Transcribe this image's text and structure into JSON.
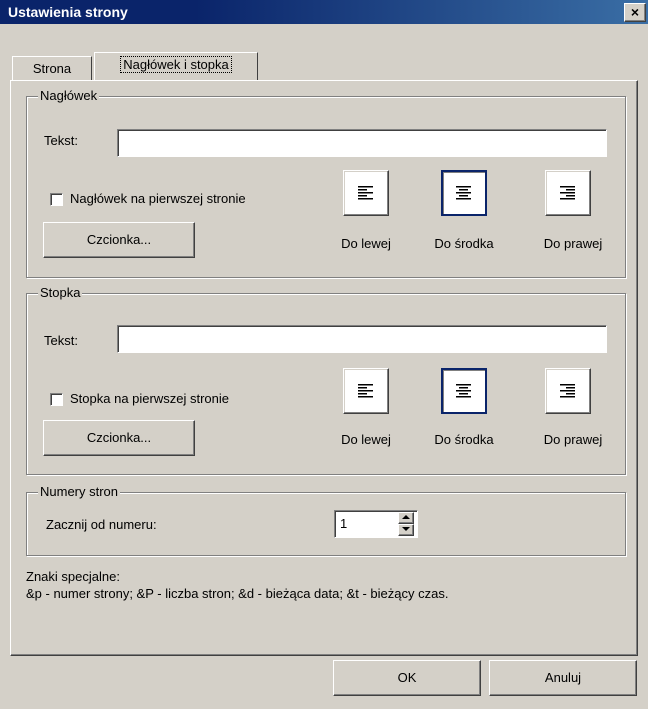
{
  "window": {
    "title": "Ustawienia strony",
    "close_label": "×"
  },
  "tabs": [
    {
      "label": "Strona",
      "active": false
    },
    {
      "label": "Nagłówek i stopka",
      "active": true
    }
  ],
  "header_group": {
    "legend": "Nagłówek",
    "text_label": "Tekst:",
    "text_value": "",
    "first_page_checkbox": {
      "label": "Nagłówek na pierwszej stronie",
      "checked": false
    },
    "font_button": "Czcionka...",
    "align": {
      "selected": "center",
      "left_label": "Do lewej",
      "center_label": "Do środka",
      "right_label": "Do prawej"
    }
  },
  "footer_group": {
    "legend": "Stopka",
    "text_label": "Tekst:",
    "text_value": "",
    "first_page_checkbox": {
      "label": "Stopka na pierwszej stronie",
      "checked": false
    },
    "font_button": "Czcionka...",
    "align": {
      "selected": "center",
      "left_label": "Do lewej",
      "center_label": "Do środka",
      "right_label": "Do prawej"
    }
  },
  "page_numbers": {
    "legend": "Numery stron",
    "start_label": "Zacznij od numeru:",
    "start_value": "1"
  },
  "special_chars": {
    "heading": "Znaki specjalne:",
    "description": "&p - numer strony; &P - liczba stron; &d - bieżąca data; &t - bieżący czas."
  },
  "buttons": {
    "ok": "OK",
    "cancel": "Anuluj"
  },
  "colors": {
    "face": "#d4d0c8",
    "titlebar": "#0a246a",
    "selected_border": "#0a246a"
  }
}
